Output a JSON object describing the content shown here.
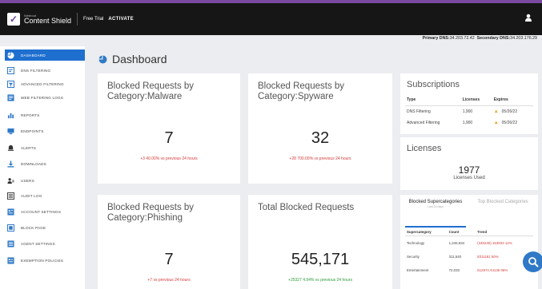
{
  "topbar": {
    "brand_small": "Webroot",
    "brand_name": "Content Shield",
    "free_trial": "Free Trial",
    "activate": "ACTIVATE",
    "accent": "#7b4aa0"
  },
  "dns": {
    "primary_label": "Primary DNS:",
    "primary_value": "34.203.72.42",
    "secondary_label": "Secondary DNS:",
    "secondary_value": "34.203.176.29"
  },
  "sidebar": {
    "items": [
      {
        "label": "Dashboard",
        "icon": "pie-chart-icon"
      },
      {
        "label": "DNS Filtering",
        "icon": "filter-icon"
      },
      {
        "label": "Advanced Filtering",
        "icon": "advanced-filter-icon"
      },
      {
        "label": "Web Filtering Logs",
        "icon": "logs-icon"
      },
      {
        "label": "Reports",
        "icon": "reports-icon"
      },
      {
        "label": "Endpoints",
        "icon": "endpoints-icon"
      },
      {
        "label": "Alerts",
        "icon": "alert-icon"
      },
      {
        "label": "Downloads",
        "icon": "download-icon"
      },
      {
        "label": "Users",
        "icon": "users-icon"
      },
      {
        "label": "Audit Log",
        "icon": "audit-icon"
      },
      {
        "label": "Account Settings",
        "icon": "account-settings-icon"
      },
      {
        "label": "Block Page",
        "icon": "block-page-icon"
      },
      {
        "label": "Agent Settings",
        "icon": "agent-settings-icon"
      },
      {
        "label": "Exemption Policies",
        "icon": "exemption-icon"
      }
    ]
  },
  "page": {
    "title": "Dashboard"
  },
  "cards": {
    "malware": {
      "title": "Blocked Requests by Category:Malware",
      "value": "7",
      "delta": "+3  40.00% vs previous 24 hours"
    },
    "spyware": {
      "title": "Blocked Requests by Category:Spyware",
      "value": "32",
      "delta": "+28  700.00% vs previous 24 hours"
    },
    "phishing": {
      "title": "Blocked Requests by Category:Phishing",
      "value": "7",
      "delta": "+7 vs previous 24 hours"
    },
    "total": {
      "title": "Total Blocked Requests",
      "value": "545,171",
      "delta": "+25327  4.94% vs previous 24 hours"
    }
  },
  "subscriptions": {
    "title": "Subscriptions",
    "headers": [
      "Type",
      "Licenses",
      "Expires"
    ],
    "rows": [
      {
        "type": "DNS Filtering",
        "licenses": "1,900",
        "expires": "05/26/22"
      },
      {
        "type": "Advanced Filtering",
        "licenses": "1,900",
        "expires": "05/26/22"
      }
    ]
  },
  "licenses": {
    "title": "Licenses",
    "value": "1977",
    "label": "Licenses Used"
  },
  "supercat": {
    "tab_active": "Blocked Supercategories",
    "tab_active_sub": "Last 30 days",
    "tab_inactive": "Top Blocked Categories",
    "headers": [
      "Supercategory",
      "Count",
      "Trend"
    ],
    "rows": [
      {
        "name": "Technology",
        "count": "1,245,934",
        "trend": "(345245) 153933 12%"
      },
      {
        "name": "Security",
        "count": "311,540",
        "trend": "8311181 50%"
      },
      {
        "name": "Entertainment",
        "count": "72,033",
        "trend": "612874 44136 06%"
      }
    ]
  }
}
